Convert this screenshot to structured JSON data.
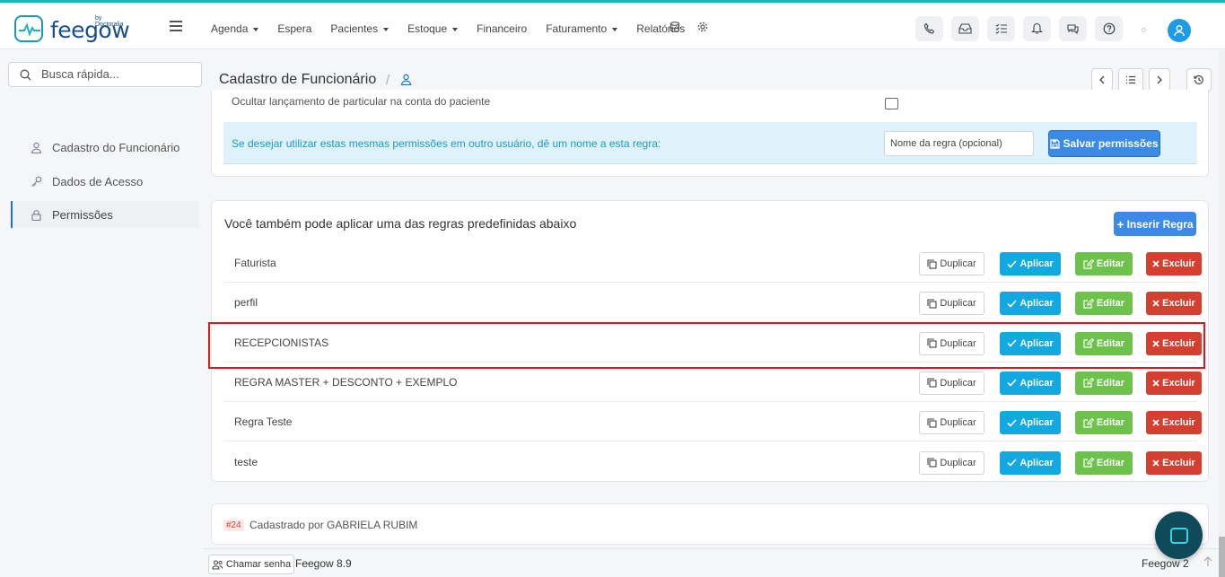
{
  "brand": {
    "name": "feegow",
    "byline": "by Doctoralia"
  },
  "nav": {
    "items": [
      {
        "label": "Agenda",
        "has_caret": true
      },
      {
        "label": "Espera",
        "has_caret": false
      },
      {
        "label": "Pacientes",
        "has_caret": true
      },
      {
        "label": "Estoque",
        "has_caret": true
      },
      {
        "label": "Financeiro",
        "has_caret": false
      },
      {
        "label": "Faturamento",
        "has_caret": true
      },
      {
        "label": "Relatórios",
        "has_caret": false
      }
    ]
  },
  "search": {
    "placeholder": "Busca rápida..."
  },
  "sidebar": {
    "items": [
      {
        "label": "Cadastro do Funcionário",
        "icon": "user-icon",
        "active": false
      },
      {
        "label": "Dados de Acesso",
        "icon": "key-icon",
        "active": false
      },
      {
        "label": "Permissões",
        "icon": "lock-icon",
        "active": true
      }
    ]
  },
  "header": {
    "title": "Cadastro de Funcionário",
    "separator": "/"
  },
  "permissions": {
    "hidden_option_label": "Ocultar lançamento de particular na conta do paciente",
    "info_text": "Se desejar utilizar estas mesmas permissões em outro usuário, dê um nome a esta regra:",
    "rule_name_placeholder": "Nome da regra (opcional)",
    "save_label": "Salvar permissões"
  },
  "rules": {
    "title": "Você também pode aplicar uma das regras predefinidas abaixo",
    "insert_label": "Inserir Regra",
    "actions": {
      "duplicate": "Duplicar",
      "apply": "Aplicar",
      "edit": "Editar",
      "delete": "Excluir"
    },
    "items": [
      {
        "name": "Faturista"
      },
      {
        "name": "perfil"
      },
      {
        "name": "RECEPCIONISTAS"
      },
      {
        "name": "REGRA MASTER + DESCONTO + EXEMPLO"
      },
      {
        "name": "Regra Teste"
      },
      {
        "name": "teste"
      }
    ]
  },
  "record": {
    "id": "#24",
    "registered_by": "Cadastrado por GABRIELA RUBIM"
  },
  "footer": {
    "call_password": "Chamar senha",
    "version_left": "Feegow 8.9",
    "version_right": "Feegow 2"
  },
  "colors": {
    "primary": "#3b8be6",
    "apply": "#12a9e0",
    "edit": "#6cc24a",
    "delete": "#d43f30",
    "highlight": "#e0161b"
  }
}
